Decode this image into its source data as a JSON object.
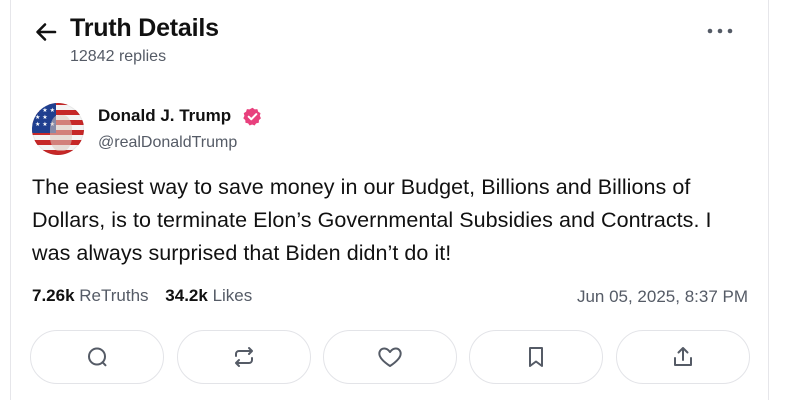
{
  "header": {
    "title": "Truth Details",
    "replies": "12842 replies",
    "back_icon": "arrow-left-icon",
    "more_icon": "more-horizontal-icon"
  },
  "post": {
    "author_name": "Donald J. Trump",
    "handle": "@realDonaldTrump",
    "verified_icon": "verified-badge-icon",
    "text": "The easiest way to save money in our Budget, Billions and Billions of Dollars, is to terminate Elon’s Governmental Subsidies and Contracts. I was always surprised that Biden didn’t do it!",
    "retruths_count": "7.26k",
    "retruths_label": "ReTruths",
    "likes_count": "34.2k",
    "likes_label": "Likes",
    "timestamp": "Jun 05, 2025, 8:37 PM"
  },
  "actions": [
    {
      "icon": "reply-icon"
    },
    {
      "icon": "retruth-icon"
    },
    {
      "icon": "heart-icon"
    },
    {
      "icon": "bookmark-icon"
    },
    {
      "icon": "share-icon"
    }
  ],
  "colors": {
    "text": "#111111",
    "muted": "#555b66",
    "border": "#e3e4e8",
    "verified": "#e8407d",
    "icon": "#555b66"
  }
}
